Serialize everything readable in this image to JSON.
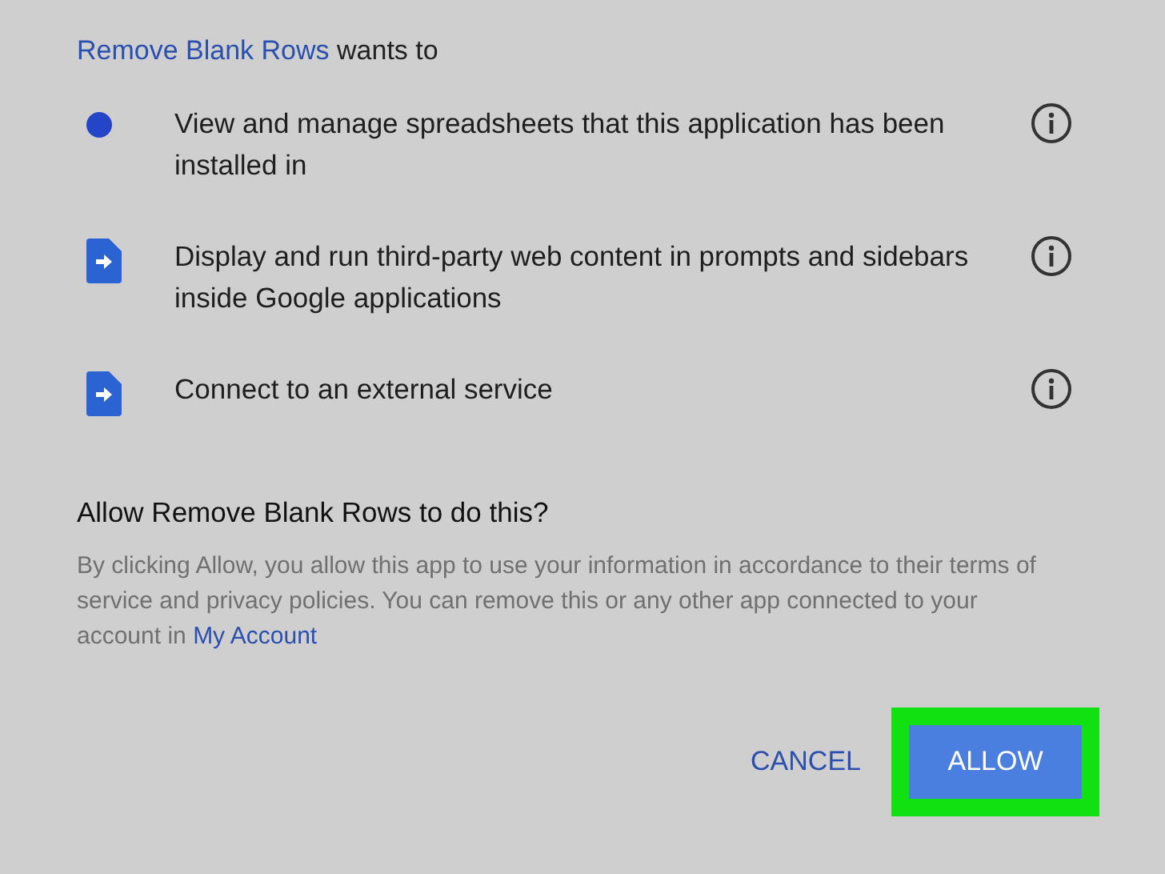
{
  "header": {
    "app_name": "Remove Blank Rows",
    "suffix": "wants to"
  },
  "permissions": [
    {
      "kind": "dot",
      "text": "View and manage spreadsheets that this application has been installed in"
    },
    {
      "kind": "file",
      "text": "Display and run third-party web content in prompts and sidebars inside Google applications"
    },
    {
      "kind": "file",
      "text": "Connect to an external service"
    }
  ],
  "question": "Allow Remove Blank Rows to do this?",
  "disclaimer": {
    "text": "By clicking Allow, you allow this app to use your information in accordance to their terms of service and privacy policies. You can remove this or any other app connected to your account in",
    "link": "My Account"
  },
  "buttons": [
    {
      "kind": "text",
      "label": "CANCEL",
      "highlighted": false
    },
    {
      "kind": "filled",
      "label": "ALLOW",
      "highlighted": true
    }
  ]
}
